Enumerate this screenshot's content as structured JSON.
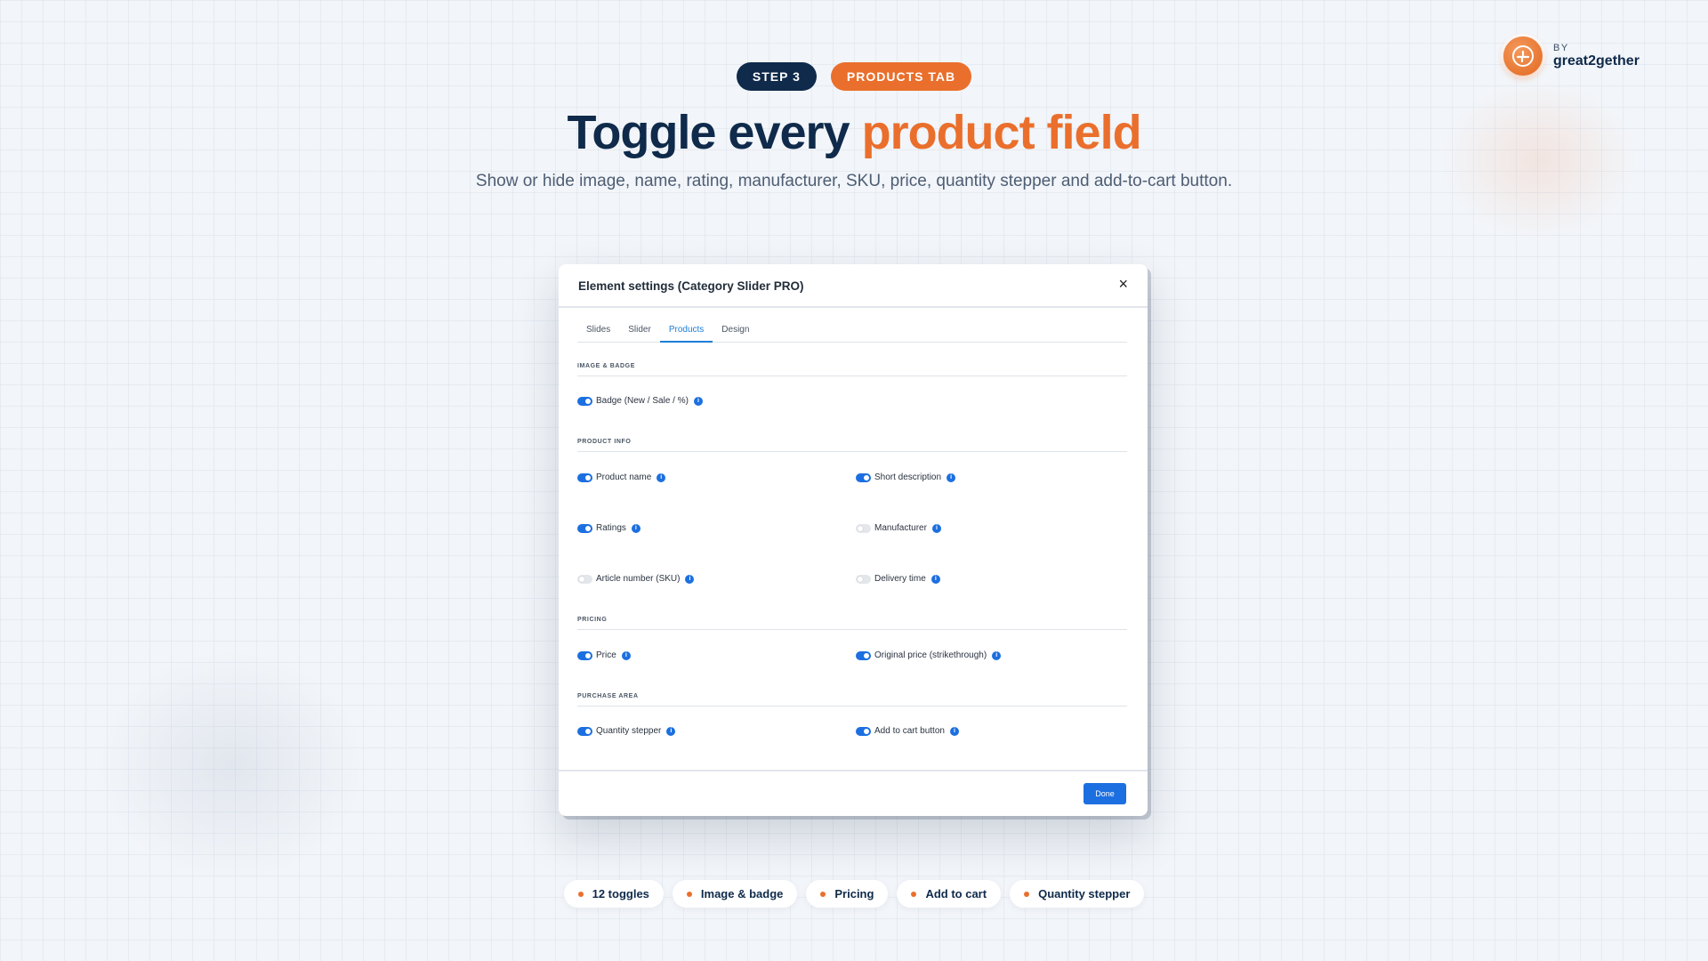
{
  "brand": {
    "by": "BY",
    "name": "great2gether"
  },
  "header": {
    "step_pill": "STEP 3",
    "tab_pill": "PRODUCTS TAB",
    "headline_main": "Toggle every",
    "headline_accent": "product field",
    "subtitle": "Show or hide image, name, rating, manufacturer, SKU, price, quantity stepper and add-to-cart button."
  },
  "modal": {
    "title": "Element settings (Category Slider PRO)",
    "close_glyph": "×",
    "tabs": [
      {
        "label": "Slides",
        "active": false
      },
      {
        "label": "Slider",
        "active": false
      },
      {
        "label": "Products",
        "active": true
      },
      {
        "label": "Design",
        "active": false
      }
    ],
    "sections": {
      "image_badge": "IMAGE & BADGE",
      "product_info": "PRODUCT INFO",
      "pricing": "PRICING",
      "purchase_area": "PURCHASE AREA"
    },
    "toggles": {
      "badge": {
        "label": "Badge (New / Sale / %)",
        "on": true
      },
      "product_name": {
        "label": "Product name",
        "on": true
      },
      "short_description": {
        "label": "Short description",
        "on": true
      },
      "ratings": {
        "label": "Ratings",
        "on": true
      },
      "manufacturer": {
        "label": "Manufacturer",
        "on": false
      },
      "sku": {
        "label": "Article number (SKU)",
        "on": false
      },
      "delivery_time": {
        "label": "Delivery time",
        "on": false
      },
      "price": {
        "label": "Price",
        "on": true
      },
      "original_price": {
        "label": "Original price (strikethrough)",
        "on": true
      },
      "quantity_stepper": {
        "label": "Quantity stepper",
        "on": true
      },
      "add_to_cart": {
        "label": "Add to cart button",
        "on": true
      }
    },
    "info_glyph": "i",
    "done_label": "Done"
  },
  "chips": [
    "12 toggles",
    "Image & badge",
    "Pricing",
    "Add to cart",
    "Quantity stepper"
  ],
  "colors": {
    "navy": "#0f2a4a",
    "orange": "#ea6f2c",
    "toggle_blue": "#1c6fe0",
    "tab_active": "#1c7ed6"
  }
}
